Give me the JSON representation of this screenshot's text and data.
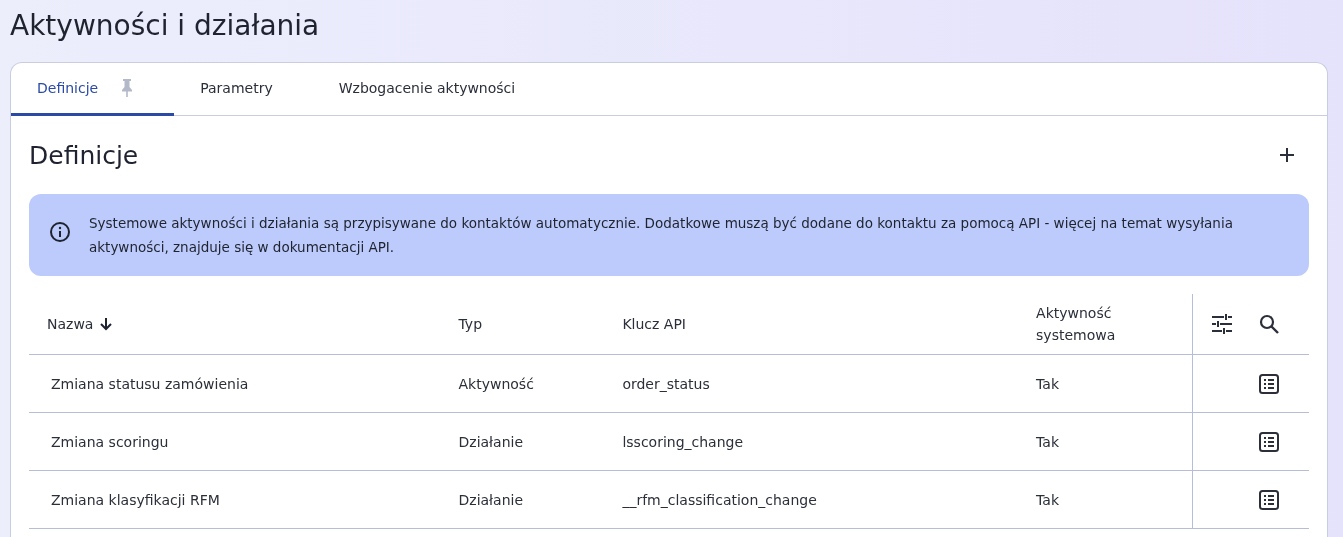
{
  "page_title": "Aktywności i działania",
  "tabs": [
    {
      "label": "Definicje",
      "selected": true,
      "pinned": true
    },
    {
      "label": "Parametry",
      "selected": false,
      "pinned": false
    },
    {
      "label": "Wzbogacenie aktywności",
      "selected": false,
      "pinned": false
    }
  ],
  "section": {
    "title": "Definicje"
  },
  "info": {
    "text": "Systemowe aktywności i działania są przypisywane do kontaktów automatycznie. Dodatkowe muszą być dodane do kontaktu za pomocą API - więcej na temat wysyłania aktywności, znajduje się w dokumentacji API."
  },
  "table": {
    "columns": [
      {
        "label": "Nazwa",
        "sorted": true
      },
      {
        "label": "Typ",
        "sorted": false
      },
      {
        "label": "Klucz API",
        "sorted": false
      },
      {
        "label": "Aktywność systemowa",
        "sorted": false
      }
    ],
    "rows": [
      {
        "cells": [
          "Zmiana statusu zamówienia",
          "Aktywność",
          "order_status",
          "Tak"
        ]
      },
      {
        "cells": [
          "Zmiana scoringu",
          "Działanie",
          "lsscoring_change",
          "Tak"
        ]
      },
      {
        "cells": [
          "Zmiana klasyfikacji RFM",
          "Działanie",
          "__rfm_classification_change",
          "Tak"
        ]
      }
    ]
  }
}
